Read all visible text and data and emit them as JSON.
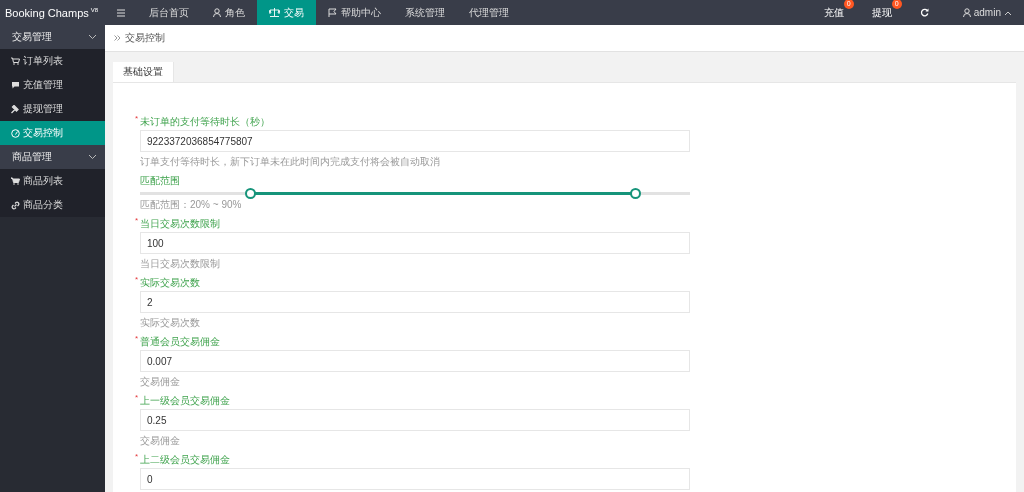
{
  "app": {
    "logo": "Booking Champs",
    "version": "V8"
  },
  "top_nav": [
    {
      "kind": "menu",
      "selected": false
    },
    {
      "kind": "link",
      "label": "后台首页",
      "selected": false
    },
    {
      "kind": "link",
      "label": "角色",
      "selected": false
    },
    {
      "kind": "link",
      "label": "交易",
      "selected": true
    },
    {
      "kind": "link",
      "label": "帮助中心",
      "selected": false
    },
    {
      "kind": "link",
      "label": "系统管理",
      "selected": false
    },
    {
      "kind": "link",
      "label": "代理管理",
      "selected": false
    }
  ],
  "top_right": [
    {
      "label": "充值",
      "badge": "0"
    },
    {
      "label": "提现",
      "badge": "0"
    }
  ],
  "user": "admin",
  "sidebar": [
    {
      "label": "交易管理",
      "expanded": true,
      "children": [
        {
          "label": "订单列表",
          "selected": false
        },
        {
          "label": "充值管理",
          "selected": false
        },
        {
          "label": "提现管理",
          "selected": false
        },
        {
          "label": "交易控制",
          "selected": true
        }
      ]
    },
    {
      "label": "商品管理",
      "expanded": true,
      "children": [
        {
          "label": "商品列表",
          "selected": false
        },
        {
          "label": "商品分类",
          "selected": false
        }
      ]
    }
  ],
  "breadcrumb": "交易控制",
  "tabs": [
    {
      "label": "基础设置",
      "selected": true
    }
  ],
  "fields": [
    {
      "kind": "text",
      "required_mark": "*",
      "label": "未订单的支付等待时长（秒）",
      "value": "9223372036854775807",
      "hint": "订单支付等待时长，新下订单未在此时间内完成支付将会被自动取消"
    },
    {
      "kind": "range",
      "label": "匹配范围",
      "thumbs": [
        {
          "level": 0.2
        },
        {
          "level": 0.9
        }
      ],
      "hint": "匹配范围：20% ~ 90%"
    },
    {
      "kind": "text",
      "required_mark": "*",
      "label": "当日交易次数限制",
      "value": "100",
      "hint": "当日交易次数限制"
    },
    {
      "kind": "text",
      "required_mark": "*",
      "label": "实际交易次数",
      "value": "2",
      "hint": "实际交易次数"
    },
    {
      "kind": "text",
      "required_mark": "*",
      "label": "普通会员交易佣金",
      "value": "0.007",
      "hint": "交易佣金"
    },
    {
      "kind": "text",
      "required_mark": "*",
      "label": "上一级会员交易佣金",
      "value": "0.25",
      "hint": "交易佣金"
    },
    {
      "kind": "text",
      "required_mark": "*",
      "label": "上二级会员交易佣金",
      "value": "0"
    }
  ]
}
